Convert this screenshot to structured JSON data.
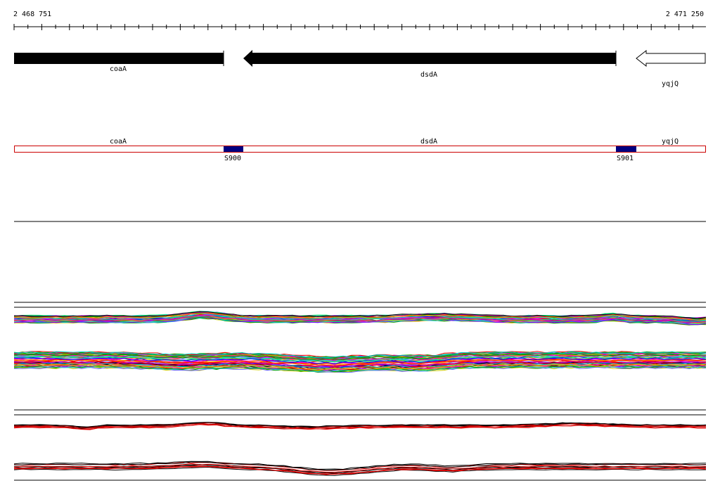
{
  "coords": {
    "start": "2 468 751",
    "end": "2 471 250"
  },
  "genes": [
    {
      "name": "coaA",
      "strand": "+",
      "filled": true
    },
    {
      "name": "dsdA",
      "strand": "-",
      "filled": true
    },
    {
      "name": "yqjQ",
      "strand": "-",
      "filled": false
    }
  ],
  "segment_track": {
    "region_labels": [
      "coaA",
      "dsdA",
      "yqjQ"
    ],
    "sites": [
      {
        "name": "S900"
      },
      {
        "name": "S901"
      }
    ],
    "colors": {
      "border": "#cc0000",
      "site": "#000080"
    }
  },
  "panels": {
    "multicolor_series_colors": [
      "#ff0000",
      "#00aa00",
      "#0000ff",
      "#ff00ff",
      "#00cccc",
      "#cccc00",
      "#ff8800",
      "#8800ff",
      "#00ff66",
      "#ff0088",
      "#6666ff",
      "#009900",
      "#cc00cc",
      "#33cccc"
    ],
    "bottom_series_colors": [
      "#000000",
      "#dd0000"
    ]
  }
}
